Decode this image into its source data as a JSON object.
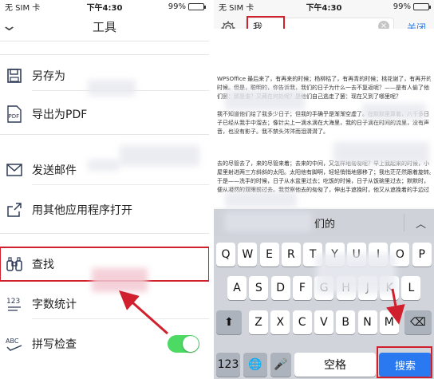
{
  "left": {
    "status": {
      "carrier": "无 SIM 卡",
      "time": "下午4:30",
      "battery": "99%"
    },
    "header": {
      "title": "工具"
    },
    "menu": [
      {
        "label": "另存为",
        "icon": "save-icon"
      },
      {
        "label": "导出为PDF",
        "icon": "pdf-icon"
      },
      {
        "label": "发送邮件",
        "icon": "mail-icon"
      },
      {
        "label": "用其他应用程序打开",
        "icon": "share-icon"
      },
      {
        "label": "查找",
        "icon": "binoculars-icon"
      },
      {
        "label": "字数统计",
        "icon": "word-count-icon"
      },
      {
        "label": "拼写检查",
        "icon": "spell-check-icon"
      }
    ],
    "spell_check_on": true
  },
  "right": {
    "status": {
      "carrier": "无 SIM 卡",
      "time": "下午4:30",
      "battery": "99%"
    },
    "search": {
      "value": "我",
      "close_label": "关闭"
    },
    "doc_lines": [
      "WPSOffice 最后来了，有再来的时候；杨柳枯了，有再青的时候；桃花谢了，有再开的",
      "时候。但是，聪明的，你告诉我，我们的日子为什么一去不复返呢？——是有人偷了他",
      "们罢：那是谁？又藏在何处呢？是他们自己逃走了罢：现在又到了哪里呢？",
      "",
      "我不知道他们给了我多少日子；但我的手确乎是渐渐空虚了。在默默里算着，八千多日",
      "子已经从我手中溜去；像针尖上一滴水滴在大海里，我的日子滴在时间的流里，没有声",
      "音，也没有影子。我不禁头涔涔而泪潸潸了。",
      "",
      "去的尽管去了，来的尽管来着；去来的中间，又怎样地匆匆呢？早上我起来的时候，小",
      "屋里射进两三方斜斜的太阳。太阳他有脚啊，轻轻悄悄地挪移了；我也茫茫然跟着旋转。",
      "于是——洗手的时候，日子从水盆里过去；吃饭的时候，日子从饭碗里过去；默默时，",
      "便从凝然的双眼前过去。我觉察他去的匆匆了，伸出手遮挽时，他又从遮挽着的手边过"
    ],
    "suggestion": "们的",
    "keyboard": {
      "row1": [
        "Q",
        "W",
        "E",
        "R",
        "T",
        "Y",
        "U",
        "I",
        "O",
        "P"
      ],
      "row2": [
        "A",
        "S",
        "D",
        "F",
        "G",
        "H",
        "J",
        "K",
        "L"
      ],
      "row3": [
        "Z",
        "X",
        "C",
        "V",
        "B",
        "N",
        "M"
      ],
      "num_label": "123",
      "space_label": "空格",
      "search_label": "搜索"
    }
  },
  "colors": {
    "highlight": "#d0202e",
    "accent_blue": "#2a79f0",
    "toggle_green": "#4cd964"
  }
}
